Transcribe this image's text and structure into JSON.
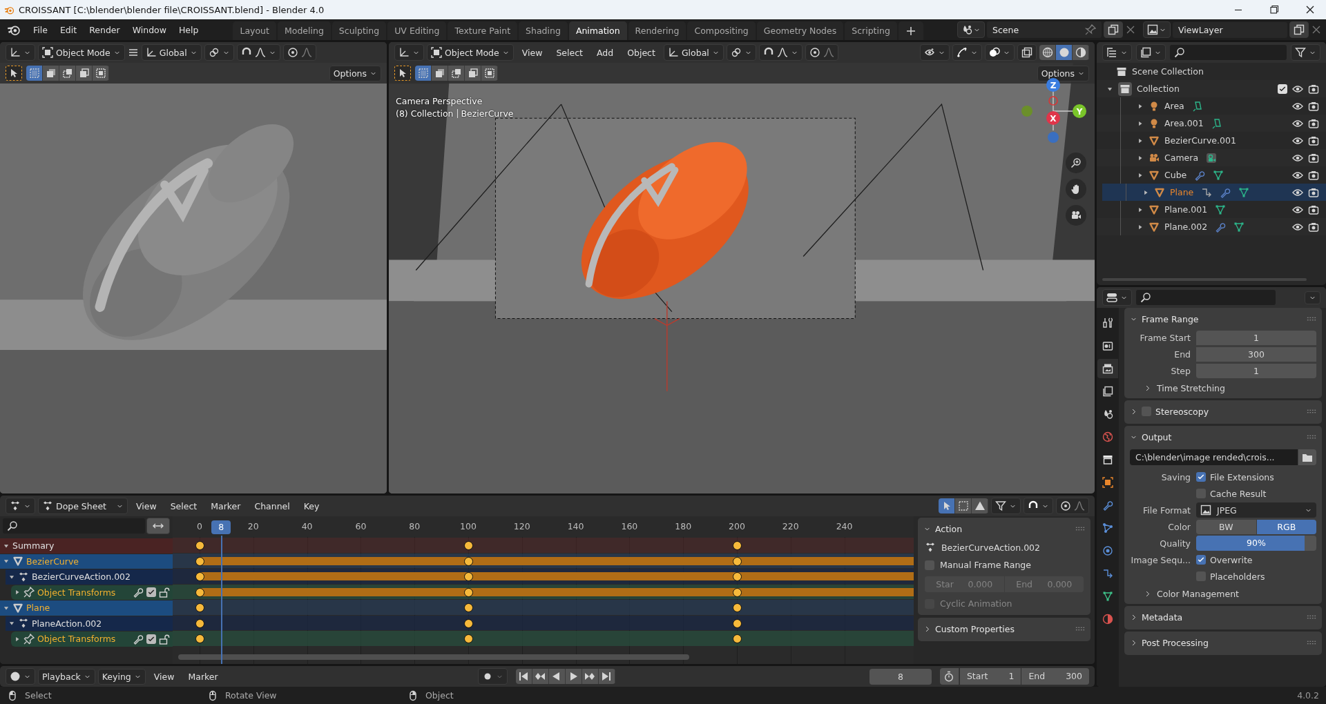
{
  "window": {
    "title": "CROISSANT [C:\\blender\\blender file\\CROISSANT.blend] - Blender 4.0"
  },
  "menu": [
    "File",
    "Edit",
    "Render",
    "Window",
    "Help"
  ],
  "workspaces": [
    {
      "label": "Layout",
      "selected": false
    },
    {
      "label": "Modeling",
      "selected": false
    },
    {
      "label": "Sculpting",
      "selected": false
    },
    {
      "label": "UV Editing",
      "selected": false
    },
    {
      "label": "Texture Paint",
      "selected": false
    },
    {
      "label": "Shading",
      "selected": false
    },
    {
      "label": "Animation",
      "selected": true
    },
    {
      "label": "Rendering",
      "selected": false
    },
    {
      "label": "Compositing",
      "selected": false
    },
    {
      "label": "Geometry Nodes",
      "selected": false
    },
    {
      "label": "Scripting",
      "selected": false
    }
  ],
  "scene": "Scene",
  "view_layer": "ViewLayer",
  "left_viewport": {
    "mode": "Object Mode",
    "orientation": "Global",
    "options": "Options"
  },
  "center_viewport": {
    "mode": "Object Mode",
    "menus": [
      "View",
      "Select",
      "Add",
      "Object"
    ],
    "orientation": "Global",
    "options": "Options",
    "view_name": "Camera Perspective",
    "collection": "(8) Collection",
    "active_object": "BezierCurve",
    "axes": [
      "Z",
      "Y",
      "X"
    ],
    "shading": [
      {
        "kind": "wireframe",
        "selected": false
      },
      {
        "kind": "solid",
        "selected": true
      },
      {
        "kind": "material",
        "selected": false
      }
    ]
  },
  "outliner": {
    "scene_collection": "Scene Collection",
    "collection": {
      "name": "Collection",
      "expanded": true,
      "included": true,
      "children": [
        {
          "name": "Area",
          "kind": "light",
          "constraint": false,
          "modifier": false,
          "data": true,
          "expanded": false,
          "selected": false
        },
        {
          "name": "Area.001",
          "kind": "light",
          "constraint": false,
          "modifier": false,
          "data": true,
          "expanded": false,
          "selected": false
        },
        {
          "name": "BezierCurve.001",
          "kind": "mesh",
          "constraint": false,
          "modifier": false,
          "data": false,
          "expanded": false,
          "selected": false
        },
        {
          "name": "Camera",
          "kind": "camera",
          "constraint": false,
          "modifier": false,
          "data": true,
          "expanded": false,
          "selected": false
        },
        {
          "name": "Cube",
          "kind": "mesh",
          "constraint": false,
          "modifier": true,
          "data": true,
          "expanded": false,
          "selected": false
        },
        {
          "name": "Plane",
          "kind": "mesh",
          "constraint": true,
          "modifier": true,
          "data": true,
          "expanded": false,
          "selected": true
        },
        {
          "name": "Plane.001",
          "kind": "mesh",
          "constraint": false,
          "modifier": false,
          "data": true,
          "expanded": false,
          "selected": false
        },
        {
          "name": "Plane.002",
          "kind": "mesh",
          "constraint": false,
          "modifier": true,
          "data": true,
          "expanded": false,
          "selected": false
        }
      ]
    }
  },
  "properties": {
    "tabs": [
      {
        "kind": "tool",
        "selected": false
      },
      {
        "kind": "render",
        "selected": false
      },
      {
        "kind": "output",
        "selected": true
      },
      {
        "kind": "viewlayer",
        "selected": false
      },
      {
        "kind": "scene",
        "selected": false
      },
      {
        "kind": "world",
        "selected": false
      },
      {
        "kind": "collection",
        "selected": false
      },
      {
        "kind": "object",
        "selected": false
      },
      {
        "kind": "modifier",
        "selected": false
      },
      {
        "kind": "particles",
        "selected": false
      },
      {
        "kind": "physics",
        "selected": false
      },
      {
        "kind": "constraint",
        "selected": false
      },
      {
        "kind": "data",
        "selected": false
      },
      {
        "kind": "material",
        "selected": false
      }
    ],
    "sections": [
      {
        "title": "Frame Range",
        "expanded": true,
        "fields": [
          {
            "kind": "number",
            "label": "Frame Start",
            "value": "1"
          },
          {
            "kind": "number",
            "label": "End",
            "value": "300"
          },
          {
            "kind": "number",
            "label": "Step",
            "value": "1"
          }
        ],
        "subpanels": [
          {
            "title": "Time Stretching",
            "expanded": false
          }
        ]
      },
      {
        "title": "Stereoscopy",
        "expanded": false,
        "enabled": false
      },
      {
        "title": "Output",
        "expanded": true,
        "fields": [
          {
            "kind": "path",
            "value": "C:\\blender\\image rended\\crois..."
          },
          {
            "kind": "check",
            "label": "Saving",
            "text": "File Extensions",
            "checked": true
          },
          {
            "kind": "check",
            "text": "Cache Result",
            "checked": false
          },
          {
            "kind": "select",
            "label": "File Format",
            "value": "JPEG"
          },
          {
            "kind": "toggle",
            "label": "Color",
            "options": [
              {
                "text": "BW",
                "selected": false
              },
              {
                "text": "RGB",
                "selected": true
              }
            ]
          },
          {
            "kind": "slider",
            "label": "Quality",
            "value": "90%",
            "level": 0.9
          },
          {
            "kind": "check",
            "label": "Image Sequ...",
            "text": "Overwrite",
            "checked": true
          },
          {
            "kind": "check",
            "text": "Placeholders",
            "checked": false
          }
        ],
        "subpanels": [
          {
            "title": "Color Management",
            "expanded": false
          }
        ]
      },
      {
        "title": "Metadata",
        "expanded": false
      },
      {
        "title": "Post Processing",
        "expanded": false
      }
    ],
    "version": "4.0.2"
  },
  "dope_sheet": {
    "editor": "Dope Sheet",
    "menus": [
      "View",
      "Select",
      "Marker",
      "Channel",
      "Key"
    ],
    "ticks": [
      {
        "label": "0",
        "keyframe": true
      },
      {
        "label": "20",
        "keyframe": false
      },
      {
        "label": "40",
        "keyframe": false
      },
      {
        "label": "60",
        "keyframe": false
      },
      {
        "label": "80",
        "keyframe": false
      },
      {
        "label": "100",
        "keyframe": true
      },
      {
        "label": "120",
        "keyframe": false
      },
      {
        "label": "140",
        "keyframe": false
      },
      {
        "label": "160",
        "keyframe": false
      },
      {
        "label": "180",
        "keyframe": false
      },
      {
        "label": "200",
        "keyframe": true
      },
      {
        "label": "220",
        "keyframe": false
      },
      {
        "label": "240",
        "keyframe": false
      }
    ],
    "current_frame": "8",
    "channels": [
      {
        "name": "Summary",
        "kind": "summary",
        "expanded": true,
        "hold": false
      },
      {
        "name": "BezierCurve",
        "kind": "object",
        "expanded": true,
        "hold": true,
        "children": [
          {
            "name": "BezierCurveAction.002",
            "kind": "action",
            "expanded": true,
            "hold": true,
            "children": [
              {
                "name": "Object Transforms",
                "kind": "group",
                "expanded": false,
                "enabled": true,
                "hold": true
              }
            ]
          }
        ]
      },
      {
        "name": "Plane",
        "kind": "object",
        "expanded": true,
        "hold": false,
        "children": [
          {
            "name": "PlaneAction.002",
            "kind": "action",
            "expanded": true,
            "hold": false,
            "children": [
              {
                "name": "Object Transforms",
                "kind": "group",
                "expanded": false,
                "enabled": true,
                "hold": false
              }
            ]
          }
        ]
      }
    ],
    "action_panel": {
      "title": "Action",
      "expanded": true,
      "action": "BezierCurveAction.002",
      "manual_range": {
        "label": "Manual Frame Range",
        "checked": false
      },
      "range": {
        "disabled": true,
        "start_label": "Star",
        "start": "0.000",
        "end_label": "End",
        "end": "0.000"
      },
      "cyclic": {
        "label": "Cyclic Animation",
        "checked": false,
        "disabled": true
      }
    },
    "custom_properties": {
      "title": "Custom Properties",
      "expanded": false
    }
  },
  "timeline": {
    "menus": [
      {
        "label": "Playback",
        "dropdown": true
      },
      {
        "label": "Keying",
        "dropdown": true
      },
      {
        "label": "View",
        "dropdown": false
      },
      {
        "label": "Marker",
        "dropdown": false
      }
    ],
    "current_frame": "8",
    "start_label": "Start",
    "start": "1",
    "end_label": "End",
    "end": "300"
  },
  "status_bar": [
    {
      "kind": "left",
      "label": "Select"
    },
    {
      "kind": "middle",
      "label": "Rotate View"
    },
    {
      "kind": "right",
      "label": "Object"
    }
  ]
}
